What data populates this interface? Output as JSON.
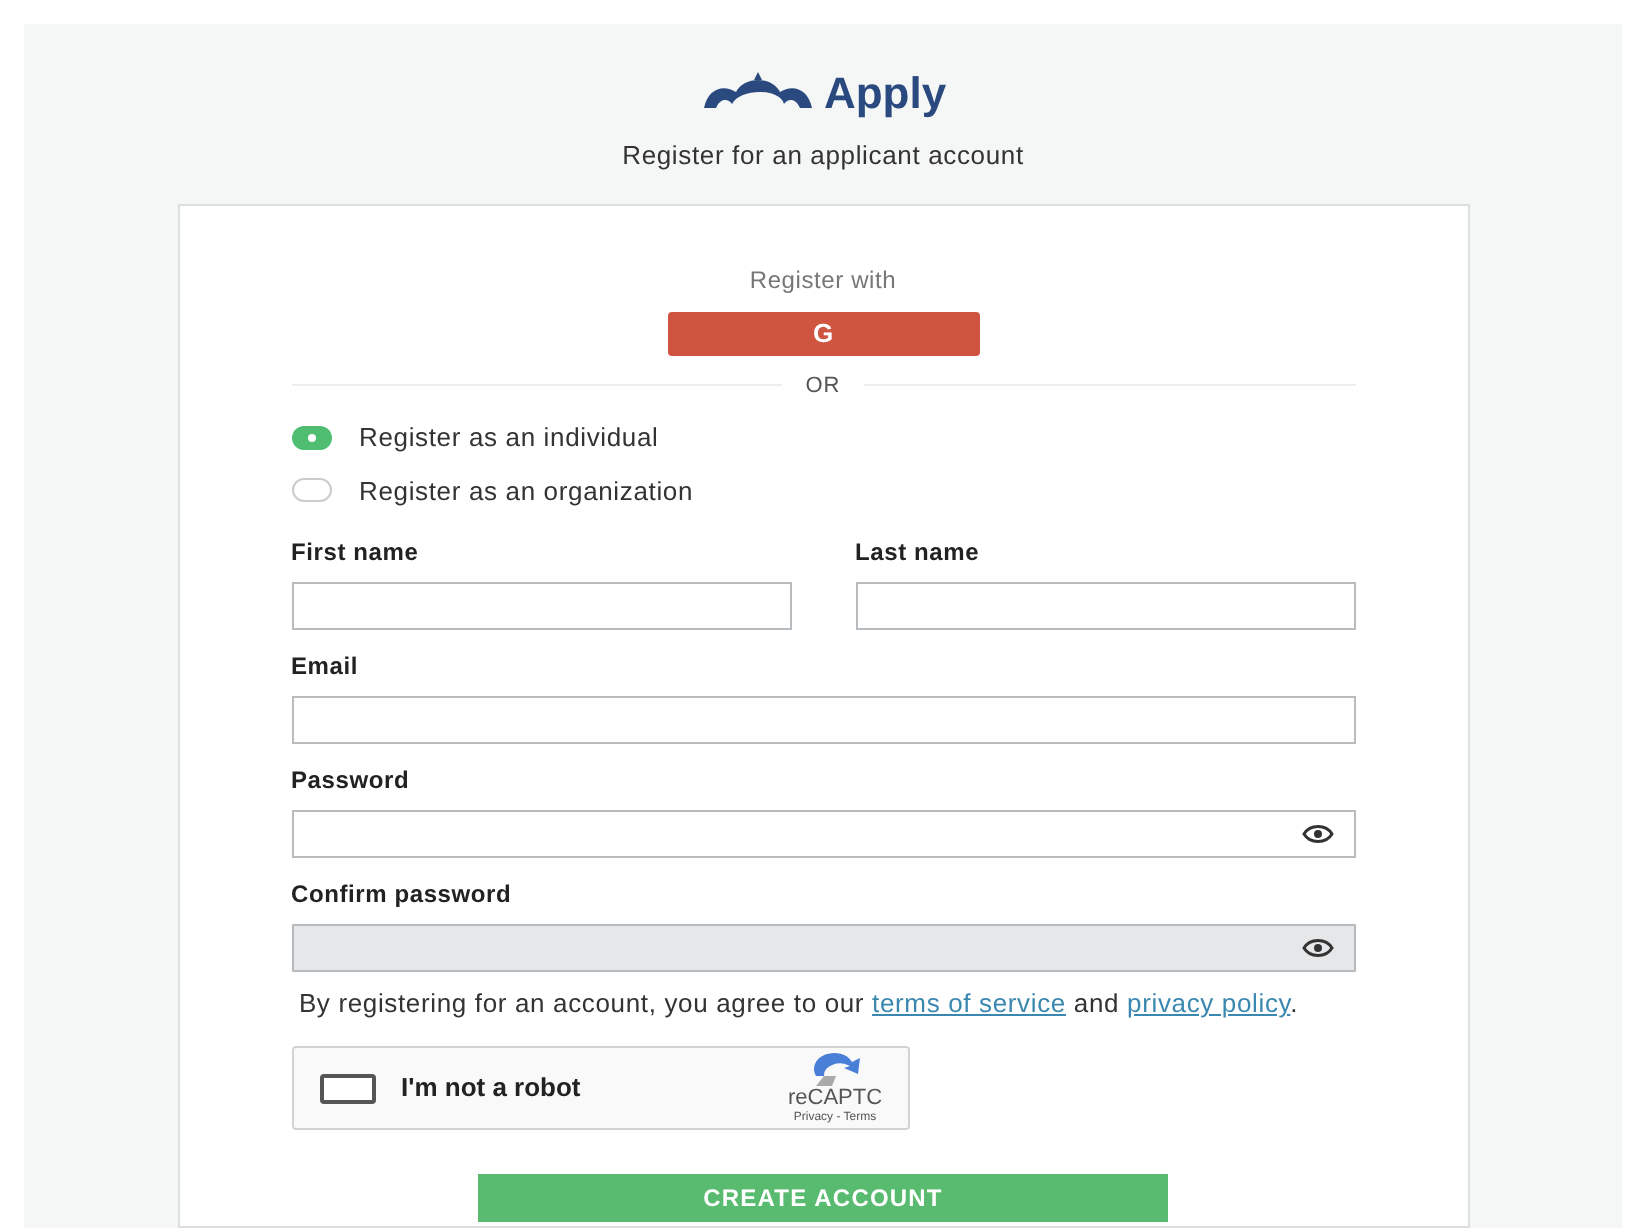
{
  "brand": {
    "name": "Apply"
  },
  "subtitle": "Register for an applicant account",
  "social": {
    "label": "Register with",
    "google_button": "G",
    "divider": "OR"
  },
  "account_types": [
    {
      "label": "Register as an individual",
      "selected": true
    },
    {
      "label": "Register as an organization",
      "selected": false
    }
  ],
  "name_fields": [
    {
      "label": "First name",
      "disabled": false
    },
    {
      "label": "Last name",
      "disabled": false
    }
  ],
  "fields": [
    {
      "label": "Email",
      "disabled": false,
      "reveal": false
    },
    {
      "label": "Password",
      "disabled": false,
      "reveal": true
    },
    {
      "label": "Confirm password",
      "disabled": true,
      "reveal": true
    }
  ],
  "agreement": {
    "before": "By registering for an account, you agree to our",
    "terms_link": "terms of service",
    "middle": "and",
    "privacy_link": "privacy policy",
    "after": "."
  },
  "captcha": {
    "label": "I'm not a robot",
    "checked": false,
    "brand": "reCAPTC",
    "footer": "Privacy - Terms"
  },
  "submit": "CREATE ACCOUNT"
}
